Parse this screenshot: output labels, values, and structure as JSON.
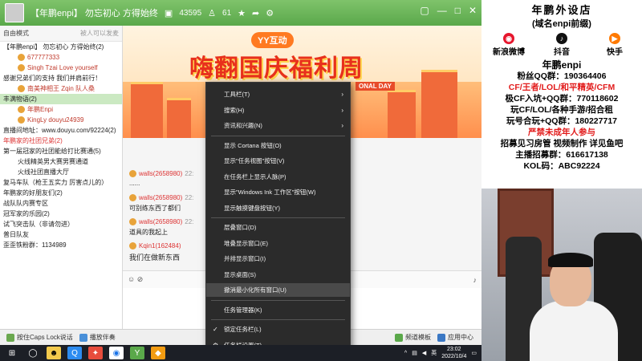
{
  "titlebar": {
    "title": "【年鹏enpi】 勿忘初心 方得始终",
    "viewers": "43595",
    "fans": "61"
  },
  "sidebar": {
    "mode": "自由模式",
    "mode_right": "被人可以发麦",
    "rows": [
      {
        "text": "【年鹏enpi】 勿忘初心 方得始终(2)",
        "style": "normal"
      },
      {
        "text": "677777333",
        "style": "user"
      },
      {
        "text": "Singh Tzai  Love yourself",
        "style": "user"
      },
      {
        "text": "感谢兄弟们的支持  我们并肩前行！",
        "style": "normal"
      },
      {
        "text": "南美神相王 Zqin  队人桑",
        "style": "user"
      },
      {
        "text": "丰满物语(2)",
        "style": "green"
      },
      {
        "text": "年鹏Enpi",
        "style": "user"
      },
      {
        "text": "KingLy  douyu24939",
        "style": "user"
      },
      {
        "text": "直播间地址：www.douyu.com/92224(2)",
        "style": "normal"
      },
      {
        "text": "年鹏家的社团兄弟(2)",
        "style": "red"
      },
      {
        "text": "第一届冠家的社团能给打比赛通(5)",
        "style": "normal"
      },
      {
        "text": "火线精英男大赛男赛通道",
        "style": "indent"
      },
      {
        "text": "火线社团直播大厅",
        "style": "indent"
      },
      {
        "text": "复马车队（枪王五实力 厉害点儿的）",
        "style": "normal"
      },
      {
        "text": "年鹏家的好朋友们(2)",
        "style": "normal"
      },
      {
        "text": "战队队内赛专区",
        "style": "normal"
      },
      {
        "text": "冠军家的乐园(2)",
        "style": "normal"
      },
      {
        "text": "试飞突击队（非请勿进）",
        "style": "normal"
      },
      {
        "text": "普日队友",
        "style": "normal"
      },
      {
        "text": "歪歪铁粉群：1134989",
        "style": "normal"
      }
    ]
  },
  "banner": {
    "tag": "YY互动",
    "headline": "嗨翻国庆福利周",
    "sub": "ONAL DAY"
  },
  "chat": {
    "messages": [
      {
        "user": "walls(2658980)",
        "time": "22:",
        "body": "......"
      },
      {
        "user": "walls(2658980)",
        "time": "22:",
        "body": "可别练东西了都们"
      },
      {
        "user": "walls(2658980)",
        "time": "22:",
        "body": "道具的我起上"
      },
      {
        "user": "Kqin1(162484)",
        "time": "22:",
        "body": "我们在做新东西"
      }
    ]
  },
  "chatbar": {
    "left": "☺ ⊘",
    "right": "♪"
  },
  "statusbar": {
    "items": [
      "按住Caps Lock说话",
      "播放伴奏",
      "频道模板",
      "应用中心"
    ]
  },
  "context_menu": {
    "items": [
      {
        "label": "工具栏(T)",
        "arrow": true
      },
      {
        "label": "搜索(H)",
        "arrow": true
      },
      {
        "label": "资讯和兴趣(N)",
        "arrow": true
      },
      {
        "label": "显示 Cortana 按钮(O)"
      },
      {
        "label": "显示\"任务视图\"按钮(V)"
      },
      {
        "label": "在任务栏上显示人脉(P)"
      },
      {
        "label": "显示\"Windows Ink 工作区\"按钮(W)"
      },
      {
        "label": "显示触摸键盘按钮(Y)"
      },
      {
        "label": "层叠窗口(D)"
      },
      {
        "label": "堆叠显示窗口(E)"
      },
      {
        "label": "并排显示窗口(I)"
      },
      {
        "label": "显示桌面(S)"
      },
      {
        "label": "撤消最小化所有窗口(U)",
        "highlight": true
      },
      {
        "label": "任务管理器(K)"
      },
      {
        "label": "锁定任务栏(L)",
        "checked": true
      },
      {
        "label": "任务栏设置(T)",
        "gear": true
      }
    ]
  },
  "taskbar": {
    "time": "23:02",
    "date": "2022/10/4",
    "lang": "英"
  },
  "panel": {
    "title": "年鹏外设店",
    "subtitle": "(域名enpi前缀)",
    "socials": [
      "新浪微博",
      "抖音",
      "快手"
    ],
    "brand": "年鹏enpi",
    "lines": [
      {
        "text": "粉丝QQ群：190364406",
        "red": false
      },
      {
        "text": "CF/王者/LOL/和平精英/CFM",
        "red": true
      },
      {
        "text": "极CF入坑+QQ群：770118602",
        "red": false
      },
      {
        "text": "玩CF/LOL/各种手游/招合租",
        "red": false
      },
      {
        "text": "玩号合玩+QQ群：180227717",
        "red": false
      },
      {
        "text": "严禁未成年人参与",
        "red": true
      },
      {
        "text": "招募见习房管 视频制作 详见鱼吧",
        "red": false
      },
      {
        "text": "主播招募群：616617138",
        "red": false
      },
      {
        "text": "KOL码：ABC92224",
        "red": false
      }
    ]
  },
  "colors": {
    "titlebar_green": "#5aa84a",
    "menu_bg": "#2b2b2b",
    "accent_red": "#e21b1b"
  }
}
